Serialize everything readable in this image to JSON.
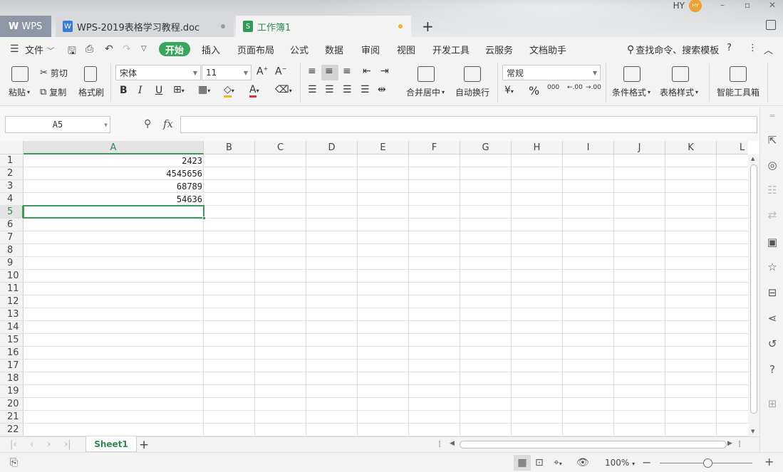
{
  "titlebar": {
    "tabs": [
      {
        "label": "WPS",
        "logo": "W"
      },
      {
        "label": "WPS-2019表格学习教程.doc",
        "icon": "W"
      },
      {
        "label": "工作簿1",
        "icon": "S"
      }
    ],
    "new_tab": "+",
    "user_name": "HY",
    "user_avatar": "HY"
  },
  "menubar": {
    "file": "文件",
    "items": [
      "开始",
      "插入",
      "页面布局",
      "公式",
      "数据",
      "审阅",
      "视图",
      "开发工具",
      "云服务",
      "文档助手"
    ],
    "search": "查找命令、搜索模板",
    "help": "?"
  },
  "ribbon": {
    "paste": "粘贴",
    "cut": "剪切",
    "copy": "复制",
    "format_painter": "格式刷",
    "font_name": "宋体",
    "font_size": "11",
    "merge_center": "合并居中",
    "wrap_text": "自动换行",
    "number_format": "常规",
    "conditional_format": "条件格式",
    "table_style": "表格样式",
    "smart_toolbox": "智能工具箱",
    "bold": "B",
    "italic": "I",
    "underline": "U",
    "percent": "%",
    "thousands": "000",
    "inc_decimal": ".00",
    "dec_decimal": ".00"
  },
  "formula_bar": {
    "name_box": "A5",
    "fx": "fx",
    "value": ""
  },
  "grid": {
    "columns": [
      "A",
      "B",
      "C",
      "D",
      "E",
      "F",
      "G",
      "H",
      "I",
      "J",
      "K",
      "L"
    ],
    "rows": [
      "1",
      "2",
      "3",
      "4",
      "5",
      "6",
      "7",
      "8",
      "9",
      "10",
      "11",
      "12",
      "13",
      "14",
      "15",
      "16",
      "17",
      "18",
      "19",
      "20",
      "21",
      "22"
    ],
    "active_column": "A",
    "active_row": "5",
    "cells": {
      "A1": "2423",
      "A2": "4545656",
      "A3": "68789",
      "A4": "54636"
    }
  },
  "sheets": {
    "tabs": [
      "Sheet1"
    ],
    "add": "+"
  },
  "statusbar": {
    "zoom": "100%",
    "zoom_value": 100
  },
  "colors": {
    "accent_green": "#3aa55c",
    "sheet_green": "#2e8b4f",
    "unsaved_dot": "#f0b429"
  }
}
